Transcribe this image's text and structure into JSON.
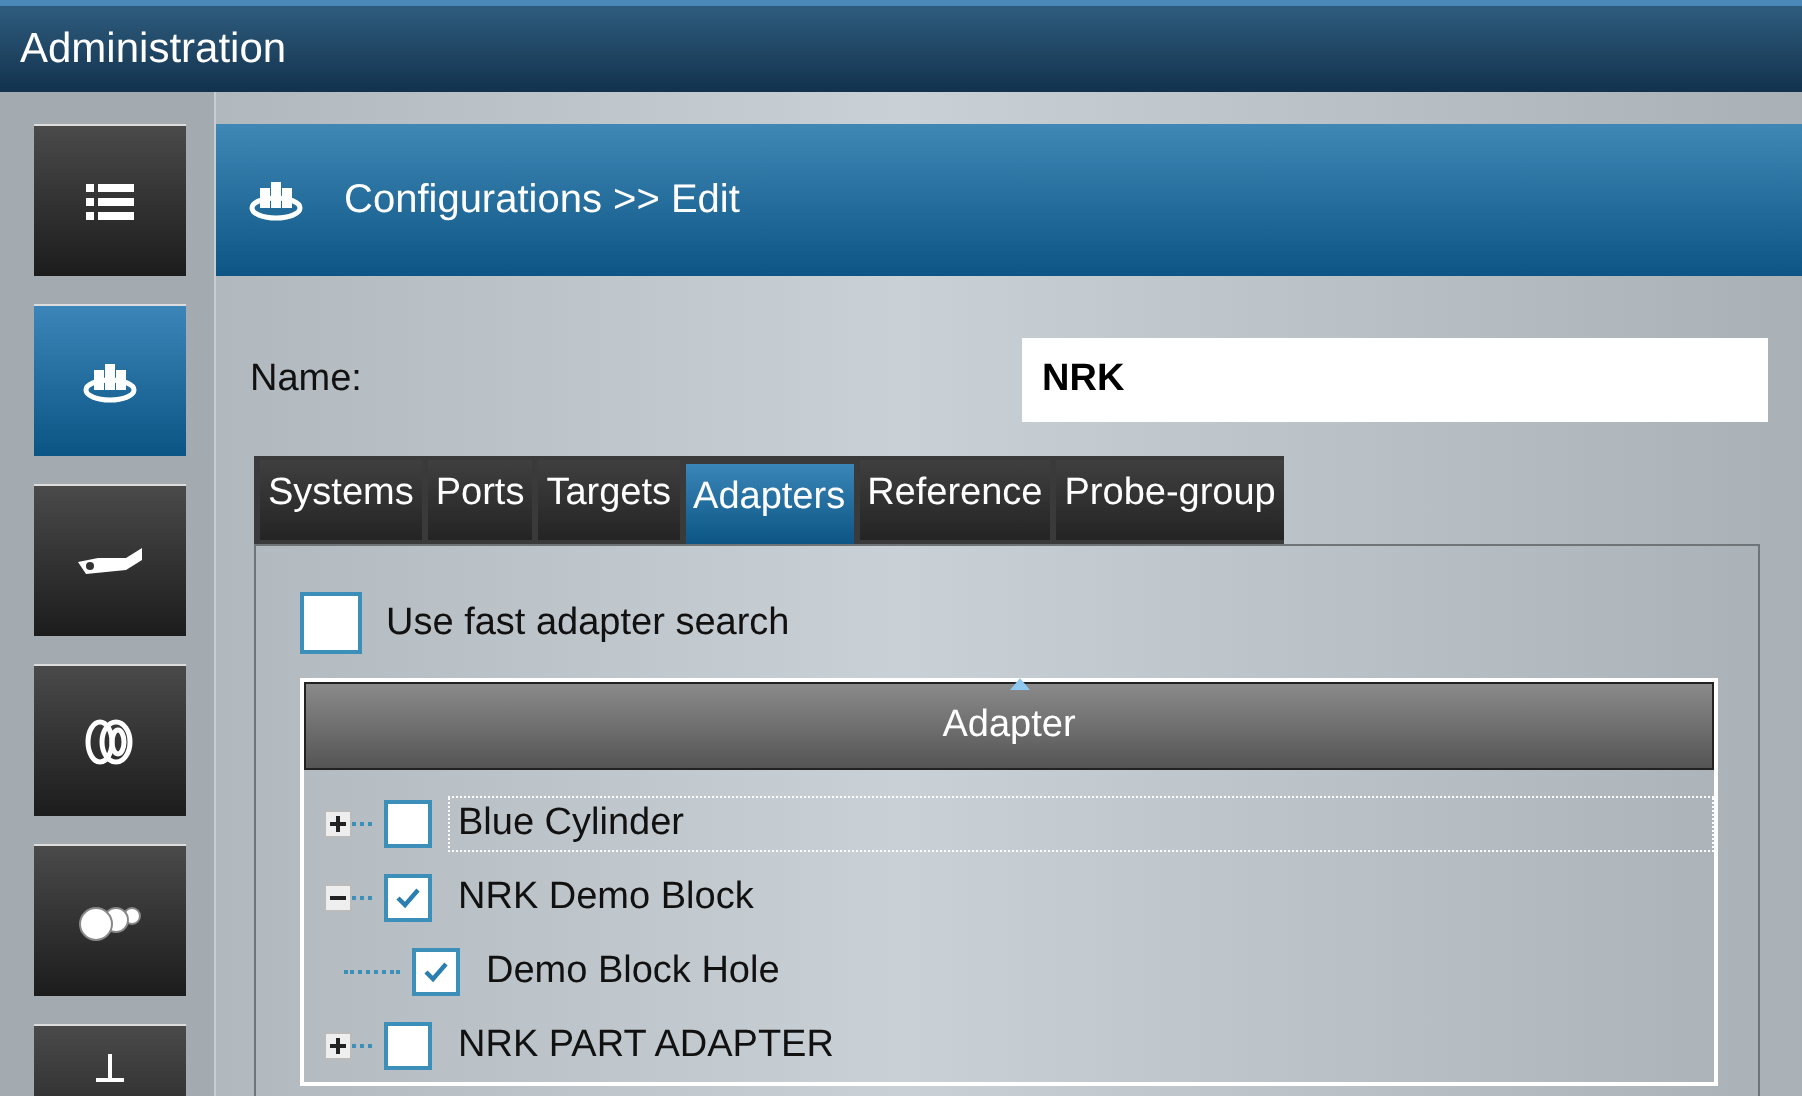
{
  "window": {
    "title": "Administration"
  },
  "sidebar": {
    "items": [
      {
        "selected": false
      },
      {
        "selected": true
      },
      {
        "selected": false
      },
      {
        "selected": false
      },
      {
        "selected": false
      },
      {
        "selected": false
      }
    ]
  },
  "header": {
    "title": "Configurations >> Edit"
  },
  "name_field": {
    "label": "Name:",
    "value": "NRK"
  },
  "tabs": [
    {
      "label": "Systems",
      "selected": false
    },
    {
      "label": "Ports",
      "selected": false
    },
    {
      "label": "Targets",
      "selected": false
    },
    {
      "label": "Adapters",
      "selected": true
    },
    {
      "label": "Reference",
      "selected": false
    },
    {
      "label": "Probe-group",
      "selected": false
    }
  ],
  "fast_search": {
    "label": "Use fast adapter search",
    "checked": false
  },
  "tree": {
    "column": "Adapter",
    "items": [
      {
        "label": "Blue Cylinder",
        "checked": false,
        "expanded": false,
        "selected": true
      },
      {
        "label": "NRK Demo Block",
        "checked": true,
        "expanded": true,
        "selected": false,
        "children": [
          {
            "label": "Demo Block Hole",
            "checked": true,
            "selected": false
          }
        ]
      },
      {
        "label": "NRK PART ADAPTER",
        "checked": false,
        "expanded": false,
        "selected": false
      }
    ]
  }
}
